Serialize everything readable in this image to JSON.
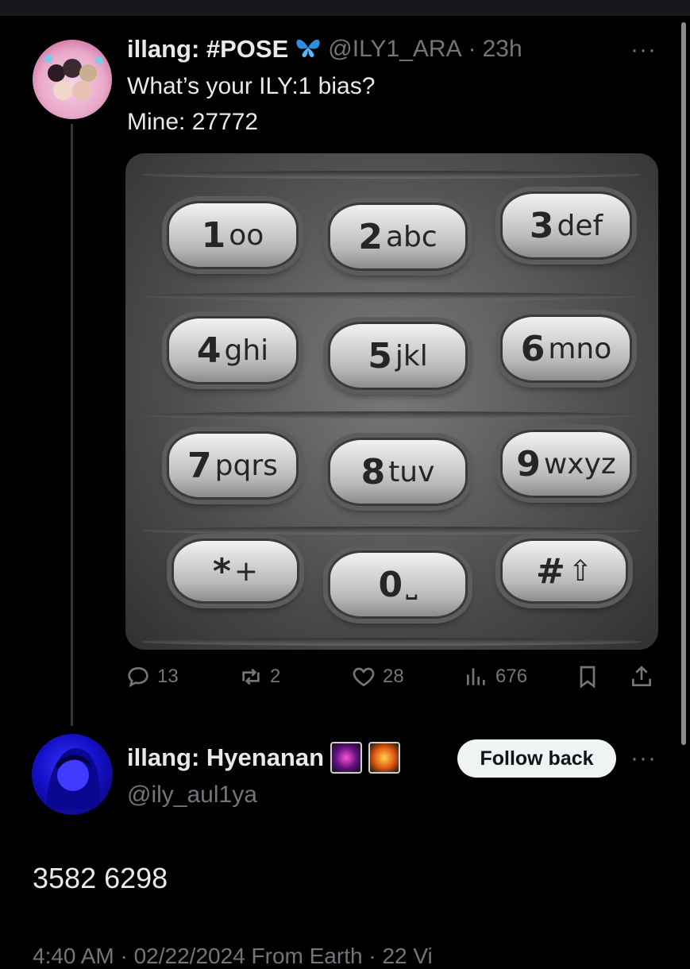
{
  "first_tweet": {
    "display_name": "illang: #POSE",
    "name_emoji": "🦋",
    "handle": "@ILY1_ARA",
    "separator": "·",
    "time": "23h",
    "line1": "What’s your ILY:1 bias?",
    "line2": "Mine: 27772",
    "keypad": [
      {
        "num": "1",
        "letters": "oo"
      },
      {
        "num": "2",
        "letters": "abc"
      },
      {
        "num": "3",
        "letters": "def"
      },
      {
        "num": "4",
        "letters": "ghi"
      },
      {
        "num": "5",
        "letters": "jkl"
      },
      {
        "num": "6",
        "letters": "mno"
      },
      {
        "num": "7",
        "letters": "pqrs"
      },
      {
        "num": "8",
        "letters": "tuv"
      },
      {
        "num": "9",
        "letters": "wxyz"
      },
      {
        "num": "*",
        "letters": "+"
      },
      {
        "num": "0",
        "letters": "⎵"
      },
      {
        "num": "#",
        "letters": "⇧"
      }
    ],
    "replies": "13",
    "reposts": "2",
    "likes": "28",
    "views": "676"
  },
  "reply": {
    "display_name": "illang: Hyenanan",
    "emoji1": "🎆",
    "emoji2": "🎇",
    "handle": "@ily_aul1ya",
    "follow_label": "Follow back",
    "text": "3582 6298",
    "footer_partial": "4:40 AM · 02/22/2024 From Earth · 22 Vi"
  },
  "icons": {
    "reply": "speech-bubble-icon",
    "repost": "repost-arrows-icon",
    "like": "heart-icon",
    "views": "bar-chart-icon",
    "bookmark": "bookmark-icon",
    "share": "share-icon",
    "more": "more-dots-icon"
  },
  "colors": {
    "background": "#000000",
    "text": "#e7e9ea",
    "muted": "#71767b",
    "follow_button": "#eff3f4"
  }
}
